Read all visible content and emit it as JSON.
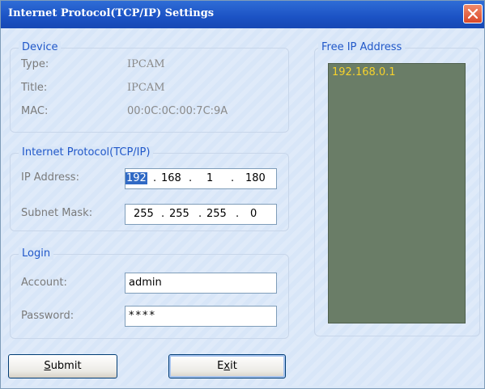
{
  "window": {
    "title": "Internet Protocol(TCP/IP) Settings"
  },
  "device": {
    "legend": "Device",
    "type_label": "Type:",
    "type_value": "IPCAM",
    "title_label": "Title:",
    "title_value": "IPCAM",
    "mac_label": "MAC:",
    "mac_value": "00:0C:0C:00:7C:9A"
  },
  "tcpip": {
    "legend": "Internet Protocol(TCP/IP)",
    "ip_label": "IP Address:",
    "ip": [
      "192",
      "168",
      "1",
      "180"
    ],
    "mask_label": "Subnet Mask:",
    "mask": [
      "255",
      "255",
      "255",
      "0"
    ]
  },
  "login": {
    "legend": "Login",
    "account_label": "Account:",
    "account_value": "admin",
    "password_label": "Password:",
    "password_value": "****"
  },
  "free_ip": {
    "legend": "Free IP Address",
    "items": [
      "192.168.0.1"
    ]
  },
  "buttons": {
    "submit_prefix": "",
    "submit_accel": "S",
    "submit_rest": "ubmit",
    "exit_prefix": "E",
    "exit_accel": "x",
    "exit_rest": "it"
  }
}
